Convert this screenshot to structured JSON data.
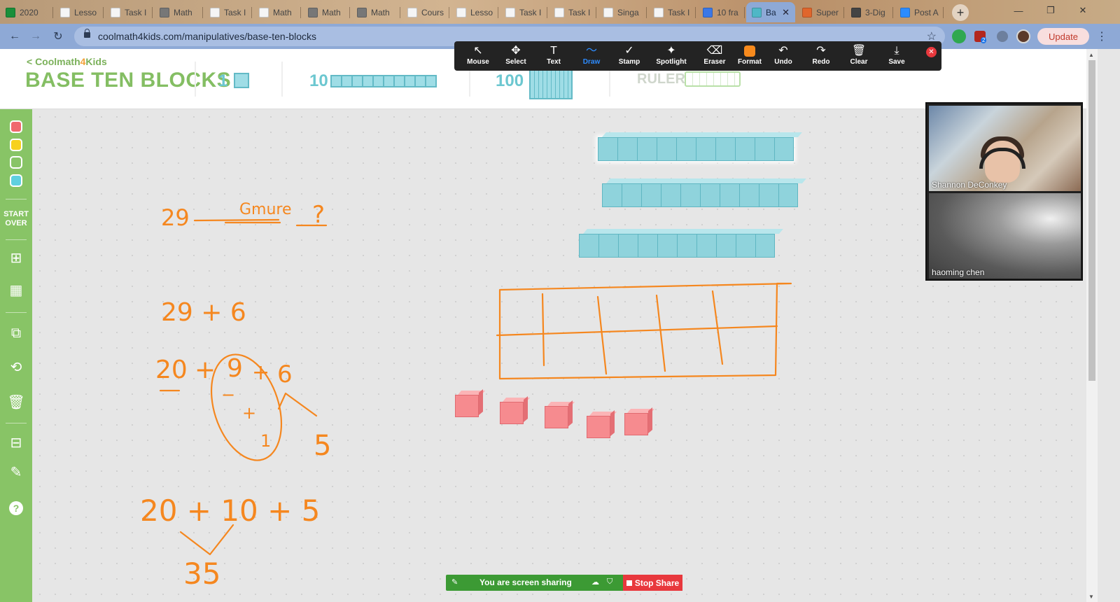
{
  "browser": {
    "tabs": [
      {
        "label": "2020",
        "icon": "green-plus-icon",
        "color": "#1a8f3a"
      },
      {
        "label": "Lesso",
        "icon": "doc-icon",
        "color": "#f5f5f5"
      },
      {
        "label": "Task I",
        "icon": "doc-icon",
        "color": "#f5f5f5"
      },
      {
        "label": "Math",
        "icon": "globe-icon",
        "color": "#777777"
      },
      {
        "label": "Task I",
        "icon": "doc-icon",
        "color": "#f5f5f5"
      },
      {
        "label": "Math",
        "icon": "doc-icon",
        "color": "#f5f5f5"
      },
      {
        "label": "Math",
        "icon": "globe-icon",
        "color": "#777777"
      },
      {
        "label": "Math",
        "icon": "globe-icon",
        "color": "#777777"
      },
      {
        "label": "Cours",
        "icon": "doc-icon",
        "color": "#f5f5f5"
      },
      {
        "label": "Lesso",
        "icon": "doc-icon",
        "color": "#f5f5f5"
      },
      {
        "label": "Task I",
        "icon": "doc-icon",
        "color": "#f5f5f5"
      },
      {
        "label": "Task I",
        "icon": "doc-icon",
        "color": "#f5f5f5"
      },
      {
        "label": "Singa",
        "icon": "doc-icon",
        "color": "#f5f5f5"
      },
      {
        "label": "Task I",
        "icon": "doc-icon",
        "color": "#f5f5f5"
      },
      {
        "label": "10 fra",
        "icon": "docs-icon",
        "color": "#3b78e7"
      },
      {
        "label": "Ba",
        "icon": "coolmath-icon",
        "color": "#4fb7c6",
        "active": true
      },
      {
        "label": "Super",
        "icon": "puzzle-icon",
        "color": "#e0662c"
      },
      {
        "label": "3-Dig",
        "icon": "co-icon",
        "color": "#444444"
      },
      {
        "label": "Post A",
        "icon": "zoom-icon",
        "color": "#2d8cff"
      }
    ],
    "new_tab_symbol": "+",
    "window_controls": [
      "—",
      "❐",
      "✕"
    ],
    "url": "coolmath4kids.com/manipulatives/base-ten-blocks",
    "update_label": "Update",
    "ext_badge": "2"
  },
  "page": {
    "logo_prefix": "< Coolmath",
    "logo_four": "4",
    "logo_suffix": "Kids",
    "title": "BASE TEN BLOCKS",
    "block_labels": {
      "one": "1",
      "ten": "10",
      "hundred": "100"
    },
    "ruler_label": "RULER"
  },
  "annotation_toolbar": {
    "tools": [
      {
        "label": "Mouse",
        "icon": "↖"
      },
      {
        "label": "Select",
        "icon": "✥"
      },
      {
        "label": "Text",
        "icon": "T"
      },
      {
        "label": "Draw",
        "icon": "〜",
        "selected": true
      },
      {
        "label": "Stamp",
        "icon": "✓"
      },
      {
        "label": "Spotlight",
        "icon": "✦"
      },
      {
        "label": "Eraser",
        "icon": "⌫"
      },
      {
        "label": "Format",
        "icon": "■"
      },
      {
        "label": "Undo",
        "icon": "↶"
      },
      {
        "label": "Redo",
        "icon": "↷"
      },
      {
        "label": "Clear",
        "icon": "🗑"
      },
      {
        "label": "Save",
        "icon": "⤓"
      }
    ],
    "format_color": "#f78a1d",
    "close_symbol": "✕"
  },
  "sidebar": {
    "swatches": [
      "#f0686e",
      "#f7d11e",
      "#88c466",
      "#5fd0e0"
    ],
    "start_over": "START OVER",
    "tools": [
      {
        "name": "add-blocks-icon",
        "glyph": "⊞"
      },
      {
        "name": "grid-icon",
        "glyph": "▦"
      },
      {
        "name": "copy-icon",
        "glyph": "⧉"
      },
      {
        "name": "regroup-icon",
        "glyph": "⟲"
      },
      {
        "name": "trash-icon",
        "glyph": "🗑"
      },
      {
        "name": "calculator-icon",
        "glyph": "⊟"
      },
      {
        "name": "pencil-icon",
        "glyph": "✎"
      }
    ],
    "help_symbol": "?"
  },
  "handwriting": {
    "line1_num": "29",
    "line1_word": "Gmure",
    "line1_q": "?",
    "line2": "29 + 6",
    "line3_a": "20",
    "line3_plus1": "+",
    "line3_b": "9",
    "line3_plus2": "+",
    "line3_c": "6",
    "circle_minus": "−",
    "circle_plus": "+",
    "circle_one": "1",
    "line3_result": "5",
    "line4": "20 + 10 + 5",
    "answer": "35"
  },
  "colors": {
    "ink": "#f5871f",
    "rod": "#8fd3dc",
    "cube": "#f68b8f",
    "sidebar": "#88c466"
  },
  "participants": [
    {
      "name": "Shannon DeConkey"
    },
    {
      "name": "haoming chen"
    }
  ],
  "share_bar": {
    "status": "You are screen sharing",
    "stop_label": "Stop Share"
  }
}
